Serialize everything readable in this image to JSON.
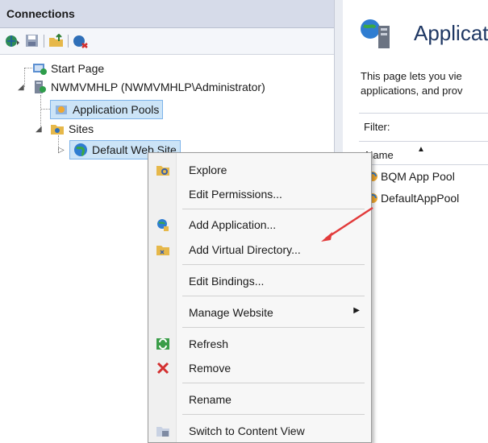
{
  "connections": {
    "title": "Connections",
    "tree": {
      "start_page": "Start Page",
      "server": "NWMVMHLP (NWMVMHLP\\Administrator)",
      "app_pools": "Application Pools",
      "sites": "Sites",
      "default_site": "Default Web Site"
    }
  },
  "right_panel": {
    "title": "Applicat",
    "desc_line1": "This page lets you vie",
    "desc_line2": "applications, and prov",
    "filter_label": "Filter:",
    "col_name": "Name",
    "rows": [
      "BQM App Pool",
      "DefaultAppPool"
    ]
  },
  "context_menu": {
    "explore": "Explore",
    "edit_permissions": "Edit Permissions...",
    "add_application": "Add Application...",
    "add_virtual_directory": "Add Virtual Directory...",
    "edit_bindings": "Edit Bindings...",
    "manage_website": "Manage Website",
    "refresh": "Refresh",
    "remove": "Remove",
    "rename": "Rename",
    "switch_content": "Switch to Content View"
  },
  "icons": {
    "connect": "globe-connect-icon",
    "save": "save-icon",
    "folder": "folder-up-icon",
    "disconnect": "disconnect-icon"
  },
  "colors": {
    "header": "#d6dbe9",
    "selection": "#cce4f7",
    "annotation_arrow": "#e23b3b"
  }
}
